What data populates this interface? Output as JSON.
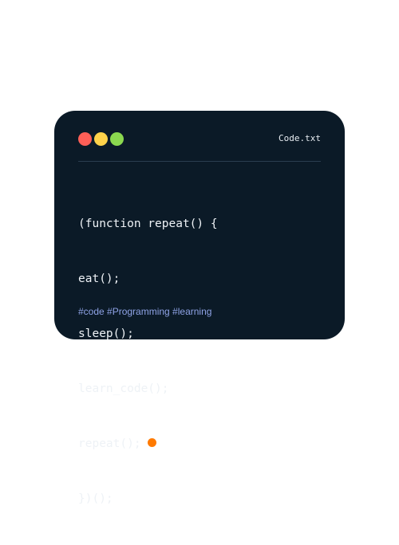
{
  "colors": {
    "card_background": "#0b1a27",
    "divider": "#2a3d50",
    "text": "#eef2f6",
    "filename": "#e8edf2",
    "tags": "#8fa3e6",
    "dot_red": "#ff5f57",
    "dot_yellow": "#ffd24a",
    "dot_green": "#8bd84f",
    "cursor": "#ff7a00"
  },
  "window": {
    "title": "Code.txt",
    "controls": [
      "close-dot",
      "minimize-dot",
      "maximize-dot"
    ]
  },
  "code": {
    "lines": [
      "(function repeat() {",
      "eat();",
      "sleep();",
      "learn_code();",
      "repeat();",
      "})();"
    ],
    "cursor_line": 5
  },
  "footer": {
    "tags": "#code #Programming #learning"
  }
}
